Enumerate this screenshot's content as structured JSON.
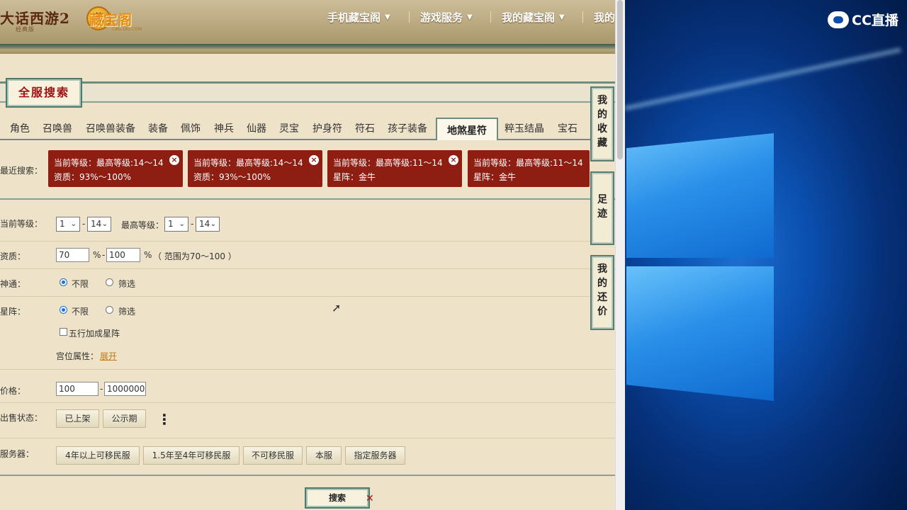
{
  "site": {
    "game_logo": "大话西游2",
    "game_logo_sub": "经典版",
    "cbg_logo": "藏宝阁",
    "cbg_url": "CBG.163.COM",
    "cbg_icon": "藏"
  },
  "topnav": [
    {
      "label": "手机藏宝阁"
    },
    {
      "label": "游戏服务"
    },
    {
      "label": "我的藏宝阁"
    },
    {
      "label": "我的"
    }
  ],
  "panel_title": "全服搜索",
  "tabs": [
    "角色",
    "召唤兽",
    "召唤兽装备",
    "装备",
    "佩饰",
    "神兵",
    "仙器",
    "灵宝",
    "护身符",
    "符石",
    "孩子装备",
    "地煞星符",
    "粹玉结晶",
    "宝石"
  ],
  "active_tab": "地煞星符",
  "recent": {
    "label": "最近搜索：",
    "chips": [
      {
        "line1": "当前等级：最高等级:14～14",
        "line2": "资质：93%～100%"
      },
      {
        "line1": "当前等级：最高等级:14～14",
        "line2": "资质：93%～100%"
      },
      {
        "line1": "当前等级：最高等级:11～14",
        "line2": "星阵：金牛"
      },
      {
        "line1": "当前等级：最高等级:11～14",
        "line2": "星阵：金牛"
      }
    ]
  },
  "form": {
    "current_level_label": "当前等级：",
    "current_level_min": "1",
    "current_level_max": "14",
    "max_level_label": "最高等级：",
    "max_level_min": "1",
    "max_level_max": "14",
    "aptitude_label": "资质：",
    "aptitude_min": "70",
    "aptitude_max": "100",
    "percent": "%",
    "aptitude_hint": "（ 范围为70～100 ）",
    "shentong_label": "神通：",
    "unlimited": "不限",
    "filter": "筛选",
    "xingzhen_label": "星阵：",
    "wuxing_checkbox": "五行加成星阵",
    "gongwei_label": "宫位属性：",
    "expand_link": "展开",
    "price_label": "价格：",
    "price_min": "100",
    "price_max": "1000000",
    "dash": "-",
    "sale_status_label": "出售状态：",
    "sale_status_options": [
      "已上架",
      "公示期"
    ],
    "more_icon": "⋮",
    "server_label": "服务器：",
    "server_options": [
      "4年以上可移民服",
      "1.5年至4年可移民服",
      "不可移民服",
      "本服",
      "指定服务器"
    ],
    "search_button": "搜索"
  },
  "side_tabs": [
    {
      "chars": [
        "我",
        "的",
        "收",
        "藏"
      ]
    },
    {
      "chars": [
        "足",
        "迹"
      ]
    },
    {
      "chars": [
        "我",
        "的",
        "还",
        "价"
      ]
    }
  ],
  "overlay": {
    "cc_logo": "CC直播"
  }
}
